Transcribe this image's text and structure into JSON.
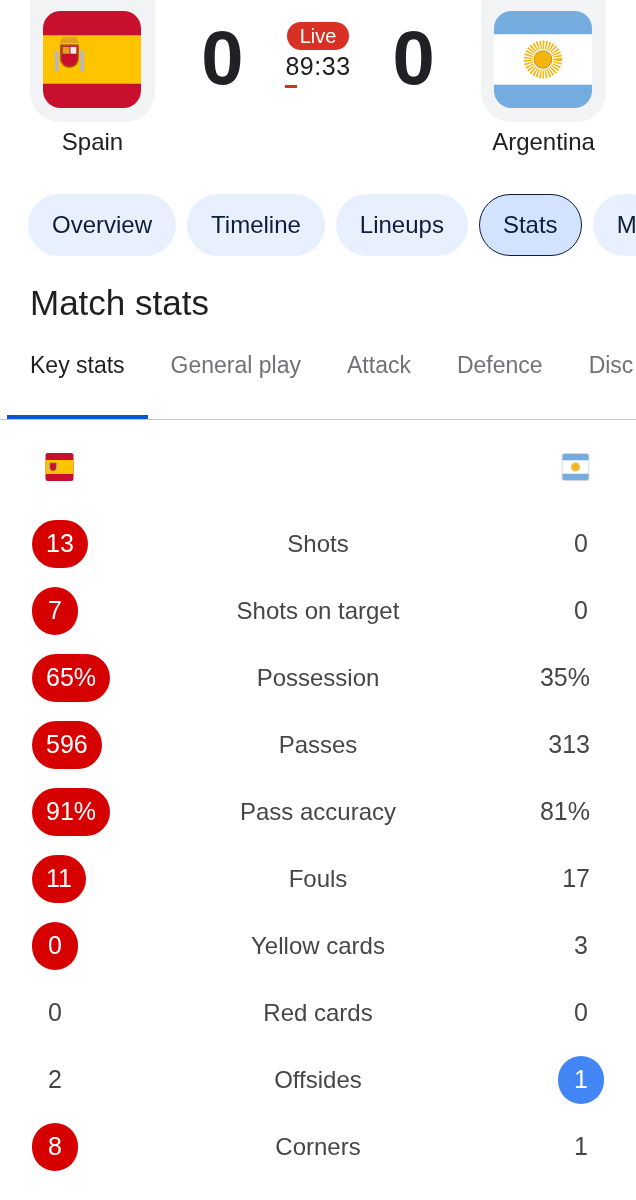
{
  "match": {
    "teams": [
      {
        "name": "Spain",
        "score": "0"
      },
      {
        "name": "Argentina",
        "score": "0"
      }
    ],
    "live": {
      "badge": "Live",
      "clock": "89:33"
    }
  },
  "chips": [
    {
      "label": "Overview",
      "selected": false
    },
    {
      "label": "Timeline",
      "selected": false
    },
    {
      "label": "Lineups",
      "selected": false
    },
    {
      "label": "Stats",
      "selected": true
    },
    {
      "label": "M",
      "selected": false
    }
  ],
  "section_title": "Match stats",
  "stat_tabs": [
    {
      "label": "Key stats",
      "selected": true
    },
    {
      "label": "General play",
      "selected": false
    },
    {
      "label": "Attack",
      "selected": false
    },
    {
      "label": "Defence",
      "selected": false
    },
    {
      "label": "Disc",
      "selected": false
    }
  ],
  "stats": [
    {
      "label": "Shots",
      "home": {
        "value": "13",
        "highlighted": true
      },
      "away": {
        "value": "0",
        "highlighted": false
      }
    },
    {
      "label": "Shots on target",
      "home": {
        "value": "7",
        "highlighted": true
      },
      "away": {
        "value": "0",
        "highlighted": false
      }
    },
    {
      "label": "Possession",
      "home": {
        "value": "65%",
        "highlighted": true
      },
      "away": {
        "value": "35%",
        "highlighted": false
      }
    },
    {
      "label": "Passes",
      "home": {
        "value": "596",
        "highlighted": true
      },
      "away": {
        "value": "313",
        "highlighted": false
      }
    },
    {
      "label": "Pass accuracy",
      "home": {
        "value": "91%",
        "highlighted": true
      },
      "away": {
        "value": "81%",
        "highlighted": false
      }
    },
    {
      "label": "Fouls",
      "home": {
        "value": "11",
        "highlighted": true
      },
      "away": {
        "value": "17",
        "highlighted": false
      }
    },
    {
      "label": "Yellow cards",
      "home": {
        "value": "0",
        "highlighted": true
      },
      "away": {
        "value": "3",
        "highlighted": false
      }
    },
    {
      "label": "Red cards",
      "home": {
        "value": "0",
        "highlighted": false
      },
      "away": {
        "value": "0",
        "highlighted": false
      }
    },
    {
      "label": "Offsides",
      "home": {
        "value": "2",
        "highlighted": false
      },
      "away": {
        "value": "1",
        "highlighted": true
      }
    },
    {
      "label": "Corners",
      "home": {
        "value": "8",
        "highlighted": true
      },
      "away": {
        "value": "1",
        "highlighted": false
      }
    }
  ]
}
